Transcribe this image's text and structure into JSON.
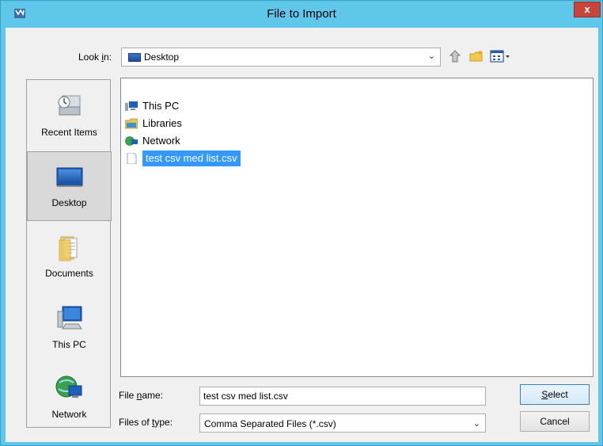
{
  "window": {
    "title": "File to Import",
    "close_label": "x"
  },
  "toolbar": {
    "look_in_label_pre": "Look ",
    "look_in_label_key": "i",
    "look_in_label_post": "n:",
    "look_in_value": "Desktop",
    "icons": [
      "up-one-level-icon",
      "new-folder-icon",
      "view-menu-icon"
    ]
  },
  "places": [
    {
      "label": "Recent Items",
      "icon": "recent-items-icon",
      "selected": false
    },
    {
      "label": "Desktop",
      "icon": "desktop-icon",
      "selected": true
    },
    {
      "label": "Documents",
      "icon": "documents-icon",
      "selected": false
    },
    {
      "label": "This PC",
      "icon": "this-pc-icon",
      "selected": false
    },
    {
      "label": "Network",
      "icon": "network-icon",
      "selected": false
    }
  ],
  "files": [
    {
      "name": "This PC",
      "icon": "this-pc-icon",
      "selected": false
    },
    {
      "name": "Libraries",
      "icon": "libraries-icon",
      "selected": false
    },
    {
      "name": "Network",
      "icon": "network-icon",
      "selected": false
    },
    {
      "name": "test csv med list.csv",
      "icon": "csv-file-icon",
      "selected": true
    }
  ],
  "form": {
    "file_name_pre": "File ",
    "file_name_key": "n",
    "file_name_post": "ame:",
    "file_name_value": "test csv med list.csv",
    "file_type_pre": "Files of ",
    "file_type_key": "t",
    "file_type_post": "ype:",
    "file_type_value": "Comma Separated Files (*.csv)"
  },
  "buttons": {
    "select_key": "S",
    "select_rest": "elect",
    "cancel_label": "Cancel"
  },
  "colors": {
    "titlebar": "#5fc8ea",
    "selection": "#3399ff",
    "close": "#c7463b"
  }
}
